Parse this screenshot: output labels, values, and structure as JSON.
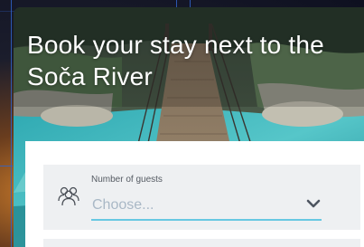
{
  "hero": {
    "title": "Book your stay next to the Soča River"
  },
  "booking_form": {
    "guests_field": {
      "label": "Number of guests",
      "placeholder": "Choose...",
      "icon": "guests-icon",
      "dropdown_icon": "chevron-down-icon"
    }
  },
  "colors": {
    "accent_underline": "#67c8e2",
    "field_background": "#eef0f2",
    "placeholder_text": "#a9b8c6"
  }
}
